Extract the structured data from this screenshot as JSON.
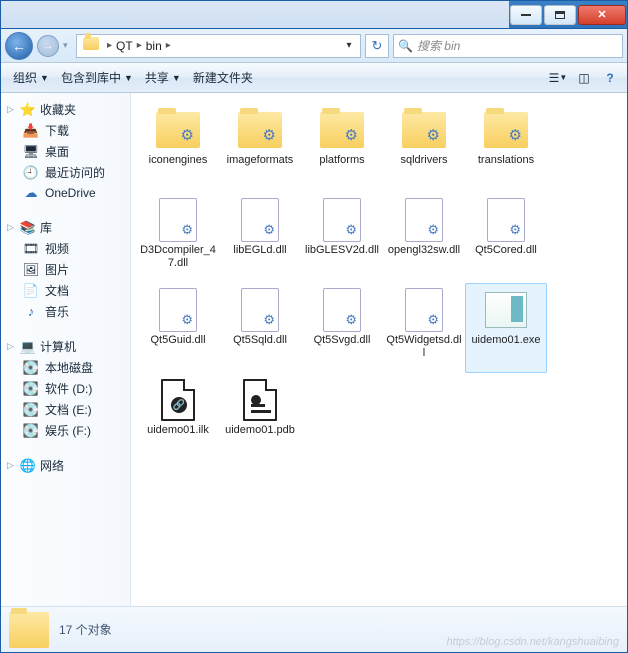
{
  "titlebar": {
    "min": "–",
    "max": "▢",
    "close": "✕"
  },
  "breadcrumbs": {
    "seg1": "QT",
    "seg2": "bin"
  },
  "search": {
    "placeholder": "搜索 bin"
  },
  "toolbar": {
    "organize": "组织",
    "include": "包含到库中",
    "share": "共享",
    "newfolder": "新建文件夹"
  },
  "sidebar": {
    "fav": {
      "head": "收藏夹",
      "items": [
        "下载",
        "桌面",
        "最近访问的",
        "OneDrive"
      ]
    },
    "lib": {
      "head": "库",
      "items": [
        "视频",
        "图片",
        "文档",
        "音乐"
      ]
    },
    "comp": {
      "head": "计算机",
      "items": [
        "本地磁盘",
        "软件 (D:)",
        "文档 (E:)",
        "娱乐 (F:)"
      ]
    },
    "net": {
      "head": "网络"
    }
  },
  "files": [
    {
      "name": "iconengines",
      "type": "folder"
    },
    {
      "name": "imageformats",
      "type": "folder"
    },
    {
      "name": "platforms",
      "type": "folder"
    },
    {
      "name": "sqldrivers",
      "type": "folder"
    },
    {
      "name": "translations",
      "type": "folder"
    },
    {
      "name": "D3Dcompiler_47.dll",
      "type": "dll"
    },
    {
      "name": "libEGLd.dll",
      "type": "dll"
    },
    {
      "name": "libGLESV2d.dll",
      "type": "dll"
    },
    {
      "name": "opengl32sw.dll",
      "type": "dll"
    },
    {
      "name": "Qt5Cored.dll",
      "type": "dll"
    },
    {
      "name": "Qt5Guid.dll",
      "type": "dll"
    },
    {
      "name": "Qt5Sqld.dll",
      "type": "dll"
    },
    {
      "name": "Qt5Svgd.dll",
      "type": "dll"
    },
    {
      "name": "Qt5Widgetsd.dll",
      "type": "dll"
    },
    {
      "name": "uidemo01.exe",
      "type": "exe",
      "selected": true
    },
    {
      "name": "uidemo01.ilk",
      "type": "ilk"
    },
    {
      "name": "uidemo01.pdb",
      "type": "pdb"
    }
  ],
  "status": {
    "count": "17 个对象"
  },
  "watermark": "https://blog.csdn.net/kangshuaibing"
}
